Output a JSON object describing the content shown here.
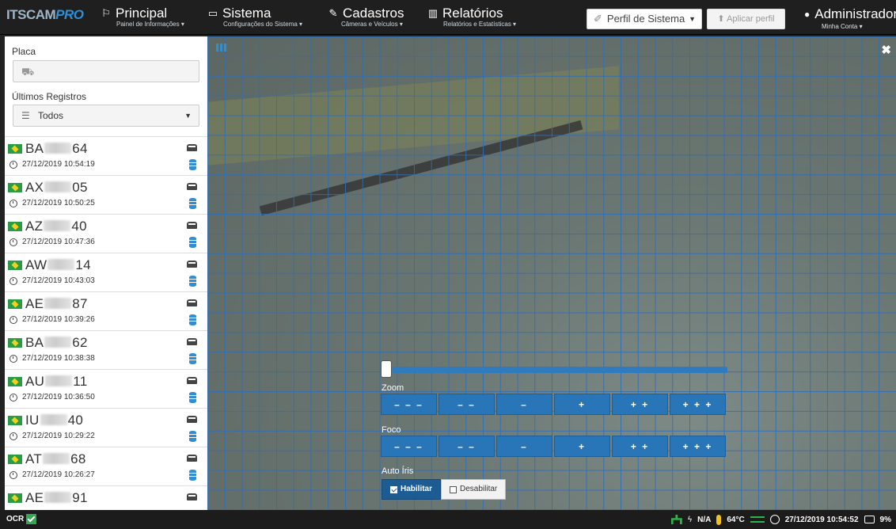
{
  "header": {
    "logo_text": "ITSCAM",
    "logo_accent": "PRO",
    "nav": [
      {
        "title": "Principal",
        "subtitle": "Painel de Informações ▾"
      },
      {
        "title": "Sistema",
        "subtitle": "Configurações do Sistema ▾"
      },
      {
        "title": "Cadastros",
        "subtitle": "Câmeras e Veículos ▾"
      },
      {
        "title": "Relatórios",
        "subtitle": "Relatórios e Estatísticas ▾"
      }
    ],
    "profile_select": "Perfil de Sistema",
    "apply_label": "Aplicar perfil",
    "user": {
      "title": "Administrador",
      "subtitle": "Minha Conta ▾"
    }
  },
  "sidebar": {
    "plate_label": "Placa",
    "plate_value": "",
    "recent_label": "Últimos Registros",
    "filter_value": "Todos",
    "records": [
      {
        "prefix": "BA",
        "suffix": "64",
        "datetime": "27/12/2019 10:54:19"
      },
      {
        "prefix": "AX",
        "suffix": "05",
        "datetime": "27/12/2019 10:50:25"
      },
      {
        "prefix": "AZ",
        "suffix": "40",
        "datetime": "27/12/2019 10:47:36"
      },
      {
        "prefix": "AW",
        "suffix": "14",
        "datetime": "27/12/2019 10:43:03"
      },
      {
        "prefix": "AE",
        "suffix": "87",
        "datetime": "27/12/2019 10:39:26"
      },
      {
        "prefix": "BA",
        "suffix": "62",
        "datetime": "27/12/2019 10:38:38"
      },
      {
        "prefix": "AU",
        "suffix": "11",
        "datetime": "27/12/2019 10:36:50"
      },
      {
        "prefix": "IU",
        "suffix": "40",
        "datetime": "27/12/2019 10:29:22"
      },
      {
        "prefix": "AT",
        "suffix": "68",
        "datetime": "27/12/2019 10:26:27"
      },
      {
        "prefix": "AE",
        "suffix": "91",
        "datetime": ""
      }
    ]
  },
  "controls": {
    "zoom_label": "Zoom",
    "focus_label": "Foco",
    "buttons": [
      "– – –",
      "– –",
      "–",
      "+",
      "+ +",
      "+ + +"
    ],
    "iris_label": "Auto Íris",
    "iris_enable": "Habilitar",
    "iris_disable": "Desabilitar"
  },
  "status": {
    "ocr": "OCR",
    "power": "N/A",
    "temperature": "64°C",
    "datetime": "27/12/2019 10:54:52",
    "disk": "9%"
  },
  "colors": {
    "accent": "#2f8fd6",
    "grid": "#2d6eb9",
    "ok": "#34a853"
  }
}
